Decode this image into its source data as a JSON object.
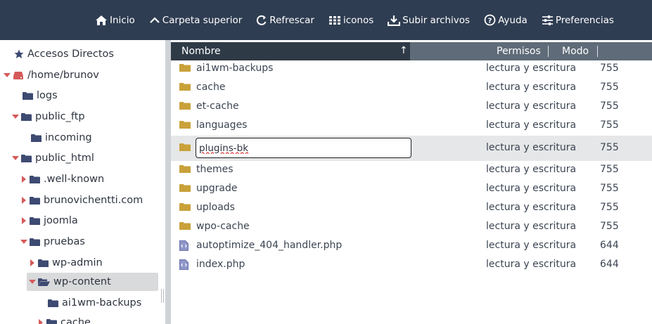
{
  "toolbar": {
    "buttons": [
      {
        "label": "Inicio",
        "icon": "home-icon"
      },
      {
        "label": "Carpeta superior",
        "icon": "chevron-up-icon"
      },
      {
        "label": "Refrescar",
        "icon": "refresh-icon"
      },
      {
        "label": "iconos",
        "icon": "grid-icon"
      },
      {
        "label": "Subir archivos",
        "icon": "upload-icon"
      },
      {
        "label": "Ayuda",
        "icon": "help-icon"
      },
      {
        "label": "Preferencias",
        "icon": "sliders-icon"
      }
    ]
  },
  "sidebar": {
    "items": [
      {
        "label": "Accesos Directos",
        "icon": "star-icon",
        "caret": "none"
      },
      {
        "label": "/home/brunov",
        "icon": "drive-icon",
        "caret": "down"
      },
      {
        "label": "logs",
        "icon": "folder-icon",
        "caret": "none"
      },
      {
        "label": "public_ftp",
        "icon": "folder-icon",
        "caret": "down"
      },
      {
        "label": "incoming",
        "icon": "folder-icon",
        "caret": "none"
      },
      {
        "label": "public_html",
        "icon": "folder-icon",
        "caret": "down"
      },
      {
        "label": ".well-known",
        "icon": "folder-icon",
        "caret": "right"
      },
      {
        "label": "brunovichentti.com",
        "icon": "folder-icon",
        "caret": "right"
      },
      {
        "label": "joomla",
        "icon": "folder-icon",
        "caret": "right"
      },
      {
        "label": "pruebas",
        "icon": "folder-icon",
        "caret": "down"
      },
      {
        "label": "wp-admin",
        "icon": "folder-icon",
        "caret": "right"
      },
      {
        "label": "wp-content",
        "icon": "folder-open-icon",
        "caret": "down",
        "selected": true
      },
      {
        "label": "ai1wm-backups",
        "icon": "folder-icon",
        "caret": "none"
      },
      {
        "label": "cache",
        "icon": "folder-icon",
        "caret": "right"
      }
    ]
  },
  "list": {
    "columns": {
      "name": "Nombre",
      "sort_indicator": "↑",
      "permissions": "Permisos",
      "mode": "Modo"
    },
    "rows": [
      {
        "name": "ai1wm-backups",
        "type": "folder",
        "permissions": "lectura y escritura",
        "mode": "755"
      },
      {
        "name": "cache",
        "type": "folder",
        "permissions": "lectura y escritura",
        "mode": "755"
      },
      {
        "name": "et-cache",
        "type": "folder",
        "permissions": "lectura y escritura",
        "mode": "755"
      },
      {
        "name": "languages",
        "type": "folder",
        "permissions": "lectura y escritura",
        "mode": "755"
      },
      {
        "name": "plugins-bk",
        "type": "folder",
        "permissions": "lectura y escritura",
        "mode": "755",
        "editing": true
      },
      {
        "name": "themes",
        "type": "folder",
        "permissions": "lectura y escritura",
        "mode": "755"
      },
      {
        "name": "upgrade",
        "type": "folder",
        "permissions": "lectura y escritura",
        "mode": "755"
      },
      {
        "name": "uploads",
        "type": "folder",
        "permissions": "lectura y escritura",
        "mode": "755"
      },
      {
        "name": "wpo-cache",
        "type": "folder",
        "permissions": "lectura y escritura",
        "mode": "755"
      },
      {
        "name": "autoptimize_404_handler.php",
        "type": "php",
        "permissions": "lectura y escritura",
        "mode": "644"
      },
      {
        "name": "index.php",
        "type": "php",
        "permissions": "lectura y escritura",
        "mode": "644"
      }
    ]
  },
  "colors": {
    "toolbar_bg": "#2f3d52",
    "folder_yellow": "#c9a13a",
    "folder_navy": "#3d4a72",
    "caret_red": "#d65a5a",
    "drive_red": "#d65a5a"
  }
}
